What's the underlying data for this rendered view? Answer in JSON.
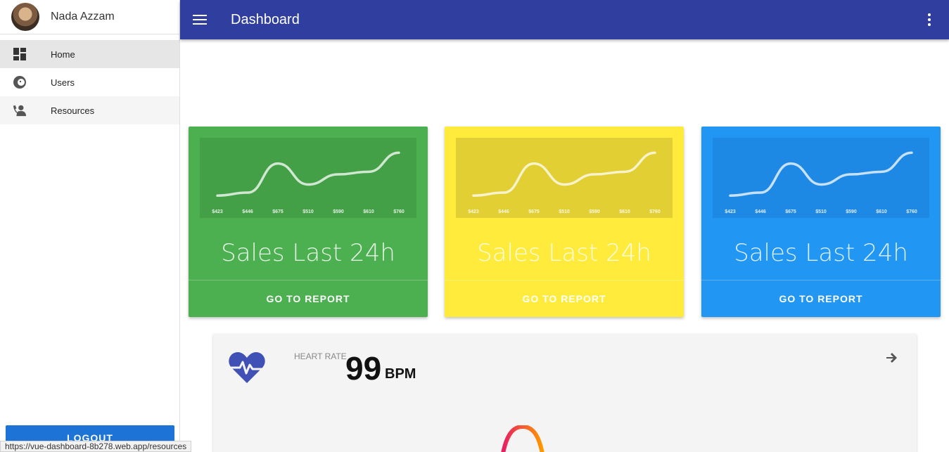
{
  "user": {
    "name": "Nada Azzam"
  },
  "sidebar": {
    "items": [
      {
        "label": "Home",
        "icon": "dashboard-icon"
      },
      {
        "label": "Users",
        "icon": "face-icon"
      },
      {
        "label": "Resources",
        "icon": "person-phone-icon"
      }
    ],
    "logout_label": "LOGOUT"
  },
  "status_url": "https://vue-dashboard-8b278.web.app/resources",
  "header": {
    "title": "Dashboard",
    "menu_icon": "hamburger-icon",
    "more_icon": "more-vert-icon"
  },
  "cards": [
    {
      "title": "Sales Last 24h",
      "button": "GO TO REPORT",
      "color": "#4caf50",
      "chart_bg": "#43a047"
    },
    {
      "title": "Sales Last 24h",
      "button": "GO TO REPORT",
      "color": "#ffeb3b",
      "chart_bg": "#e2cf33"
    },
    {
      "title": "Sales Last 24h",
      "button": "GO TO REPORT",
      "color": "#2196f3",
      "chart_bg": "#1e88e5"
    }
  ],
  "chart_data": {
    "type": "line",
    "categories": [
      "$423",
      "$446",
      "$675",
      "$510",
      "$590",
      "$610",
      "$760"
    ],
    "values": [
      423,
      446,
      675,
      510,
      590,
      610,
      760
    ]
  },
  "heart_rate": {
    "label": "HEART RATE",
    "value": "99",
    "unit": "BPM",
    "icon": "heart-pulse-icon",
    "arrow_icon": "arrow-right-icon",
    "accent": "#3f51b5"
  }
}
